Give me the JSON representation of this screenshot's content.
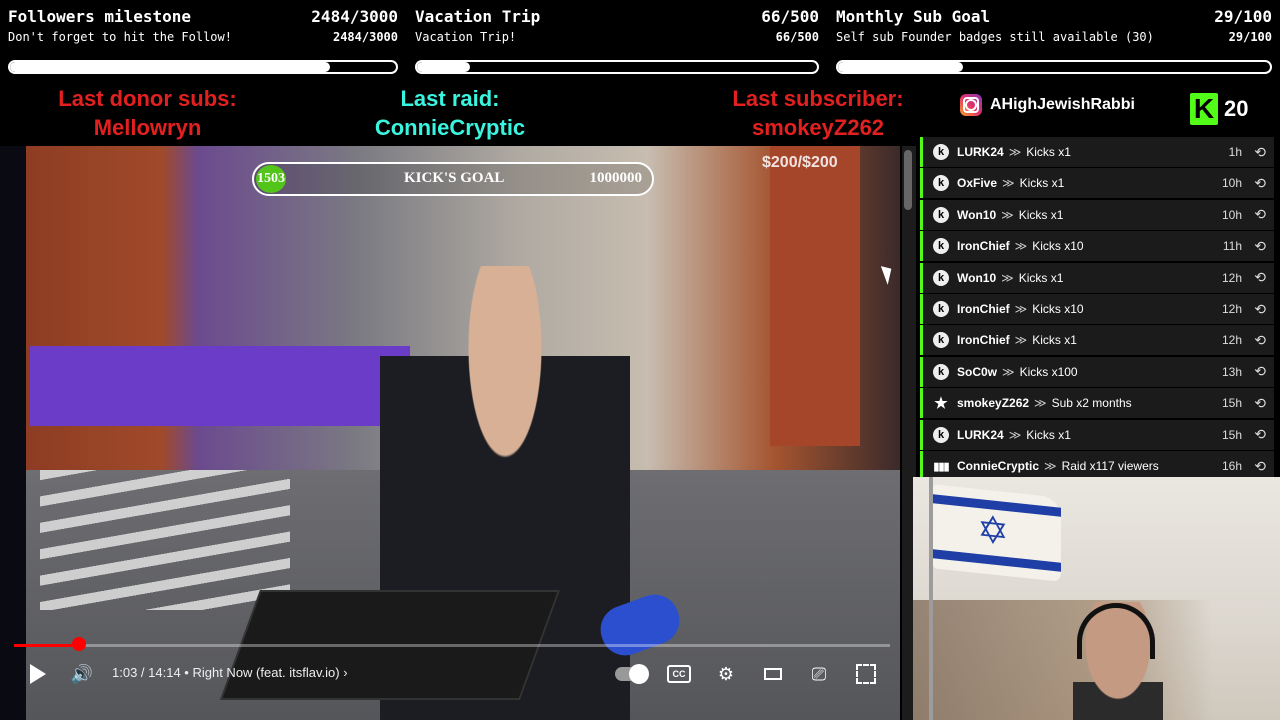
{
  "goals": [
    {
      "title": "Followers milestone",
      "count": "2484/3000",
      "subtitle": "Don't forget to hit the Follow!",
      "subcount": "2484/3000",
      "progress": 0.828
    },
    {
      "title": "Vacation Trip",
      "count": "66/500",
      "subtitle": "Vacation Trip!",
      "subcount": "66/500",
      "progress": 0.132
    },
    {
      "title": "Monthly Sub Goal",
      "count": "29/100",
      "subtitle": "Self sub Founder badges still available (30)",
      "subcount": "29/100",
      "progress": 0.29
    }
  ],
  "alerts": {
    "donor": {
      "label": "Last donor subs:",
      "value": "Mellowryn"
    },
    "raid": {
      "label": "Last raid:",
      "value": "ConnieCryptic"
    },
    "subscriber": {
      "label": "Last subscriber:",
      "value": "smokeyZ262"
    }
  },
  "social": {
    "handle": "AHighJewishRabbi",
    "icon": "instagram-icon"
  },
  "kick": {
    "count": "20",
    "icon": "kick-logo-icon",
    "accent": "#53fc18"
  },
  "video": {
    "kicks_goal": {
      "current": "1503",
      "label": "KICK'S GOAL",
      "target": "1000000"
    },
    "donation": "$200/$200",
    "time": "1:03 / 14:14",
    "track": "Right Now (feat. itsflav.io)",
    "progress": 0.073
  },
  "feed": [
    {
      "user": "LURK24",
      "action": "Kicks x1",
      "time": "1h",
      "type": "kick"
    },
    {
      "user": "OxFive",
      "action": "Kicks x1",
      "time": "10h",
      "type": "kick"
    },
    {
      "user": "Won10",
      "action": "Kicks x1",
      "time": "10h",
      "type": "kick"
    },
    {
      "user": "IronChief",
      "action": "Kicks x10",
      "time": "11h",
      "type": "kick"
    },
    {
      "user": "Won10",
      "action": "Kicks x1",
      "time": "12h",
      "type": "kick"
    },
    {
      "user": "IronChief",
      "action": "Kicks x10",
      "time": "12h",
      "type": "kick"
    },
    {
      "user": "IronChief",
      "action": "Kicks x1",
      "time": "12h",
      "type": "kick"
    },
    {
      "user": "SoC0w",
      "action": "Kicks x100",
      "time": "13h",
      "type": "kick"
    },
    {
      "user": "smokeyZ262",
      "action": "Sub x2 months",
      "time": "15h",
      "type": "sub"
    },
    {
      "user": "LURK24",
      "action": "Kicks x1",
      "time": "15h",
      "type": "kick"
    },
    {
      "user": "ConnieCryptic",
      "action": "Raid x117 viewers",
      "time": "16h",
      "type": "raid"
    }
  ],
  "feed_arrow": "≫",
  "icons": {
    "kick": "k",
    "sub": "★",
    "raid": "▮▮▮",
    "replay": "⟲"
  }
}
